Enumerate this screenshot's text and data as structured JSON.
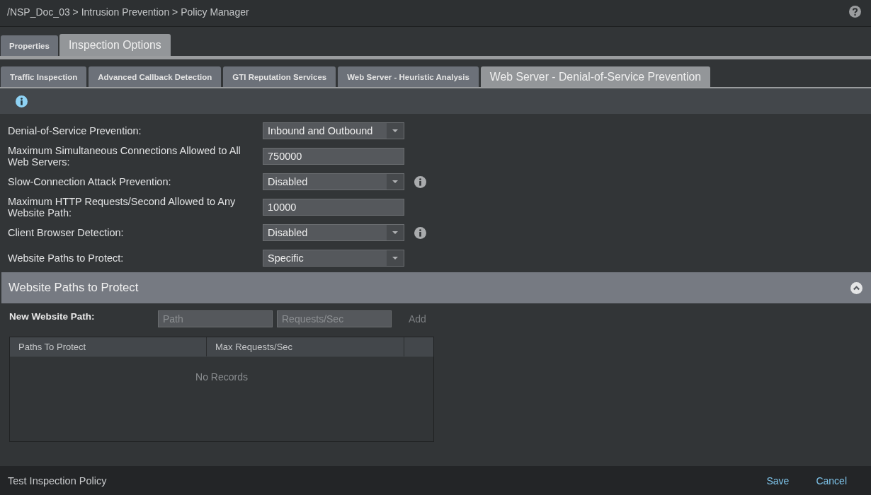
{
  "breadcrumb": "/NSP_Doc_03 > Intrusion Prevention > Policy Manager",
  "tabs": [
    {
      "label": "Properties",
      "selected": false
    },
    {
      "label": "Inspection Options",
      "selected": true
    }
  ],
  "subtabs": [
    {
      "label": "Traffic Inspection",
      "selected": false
    },
    {
      "label": "Advanced Callback Detection",
      "selected": false
    },
    {
      "label": "GTI Reputation Services",
      "selected": false
    },
    {
      "label": "Web Server - Heuristic Analysis",
      "selected": false
    },
    {
      "label": "Web Server - Denial-of-Service Prevention",
      "selected": true
    }
  ],
  "settings": [
    {
      "kind": "select",
      "label": "Denial-of-Service Prevention:",
      "value": "Inbound and Outbound",
      "info": false
    },
    {
      "kind": "input",
      "label": "Maximum Simultaneous Connections Allowed to All Web Servers:",
      "value": "750000",
      "info": false
    },
    {
      "kind": "select",
      "label": "Slow-Connection Attack Prevention:",
      "value": "Disabled",
      "info": true
    },
    {
      "kind": "input",
      "label": "Maximum HTTP Requests/Second Allowed to Any Website Path:",
      "value": "10000",
      "info": false
    },
    {
      "kind": "select",
      "label": "Client Browser Detection:",
      "value": "Disabled",
      "info": true
    },
    {
      "kind": "select",
      "label": "Website Paths to Protect:",
      "value": "Specific",
      "info": false
    }
  ],
  "section": {
    "title": "Website Paths to Protect",
    "expanded": true
  },
  "new_path": {
    "label": "New Website Path:",
    "fields": [
      {
        "placeholder": "Path"
      },
      {
        "placeholder": "Requests/Sec"
      }
    ],
    "add": {
      "label": "Add",
      "disabled": true
    }
  },
  "table": {
    "columns": [
      "Paths To Protect",
      "Max Requests/Sec"
    ],
    "empty_text": "No Records"
  },
  "footer": {
    "link": "Test Inspection Policy",
    "buttons": [
      "Save",
      "Cancel"
    ]
  }
}
